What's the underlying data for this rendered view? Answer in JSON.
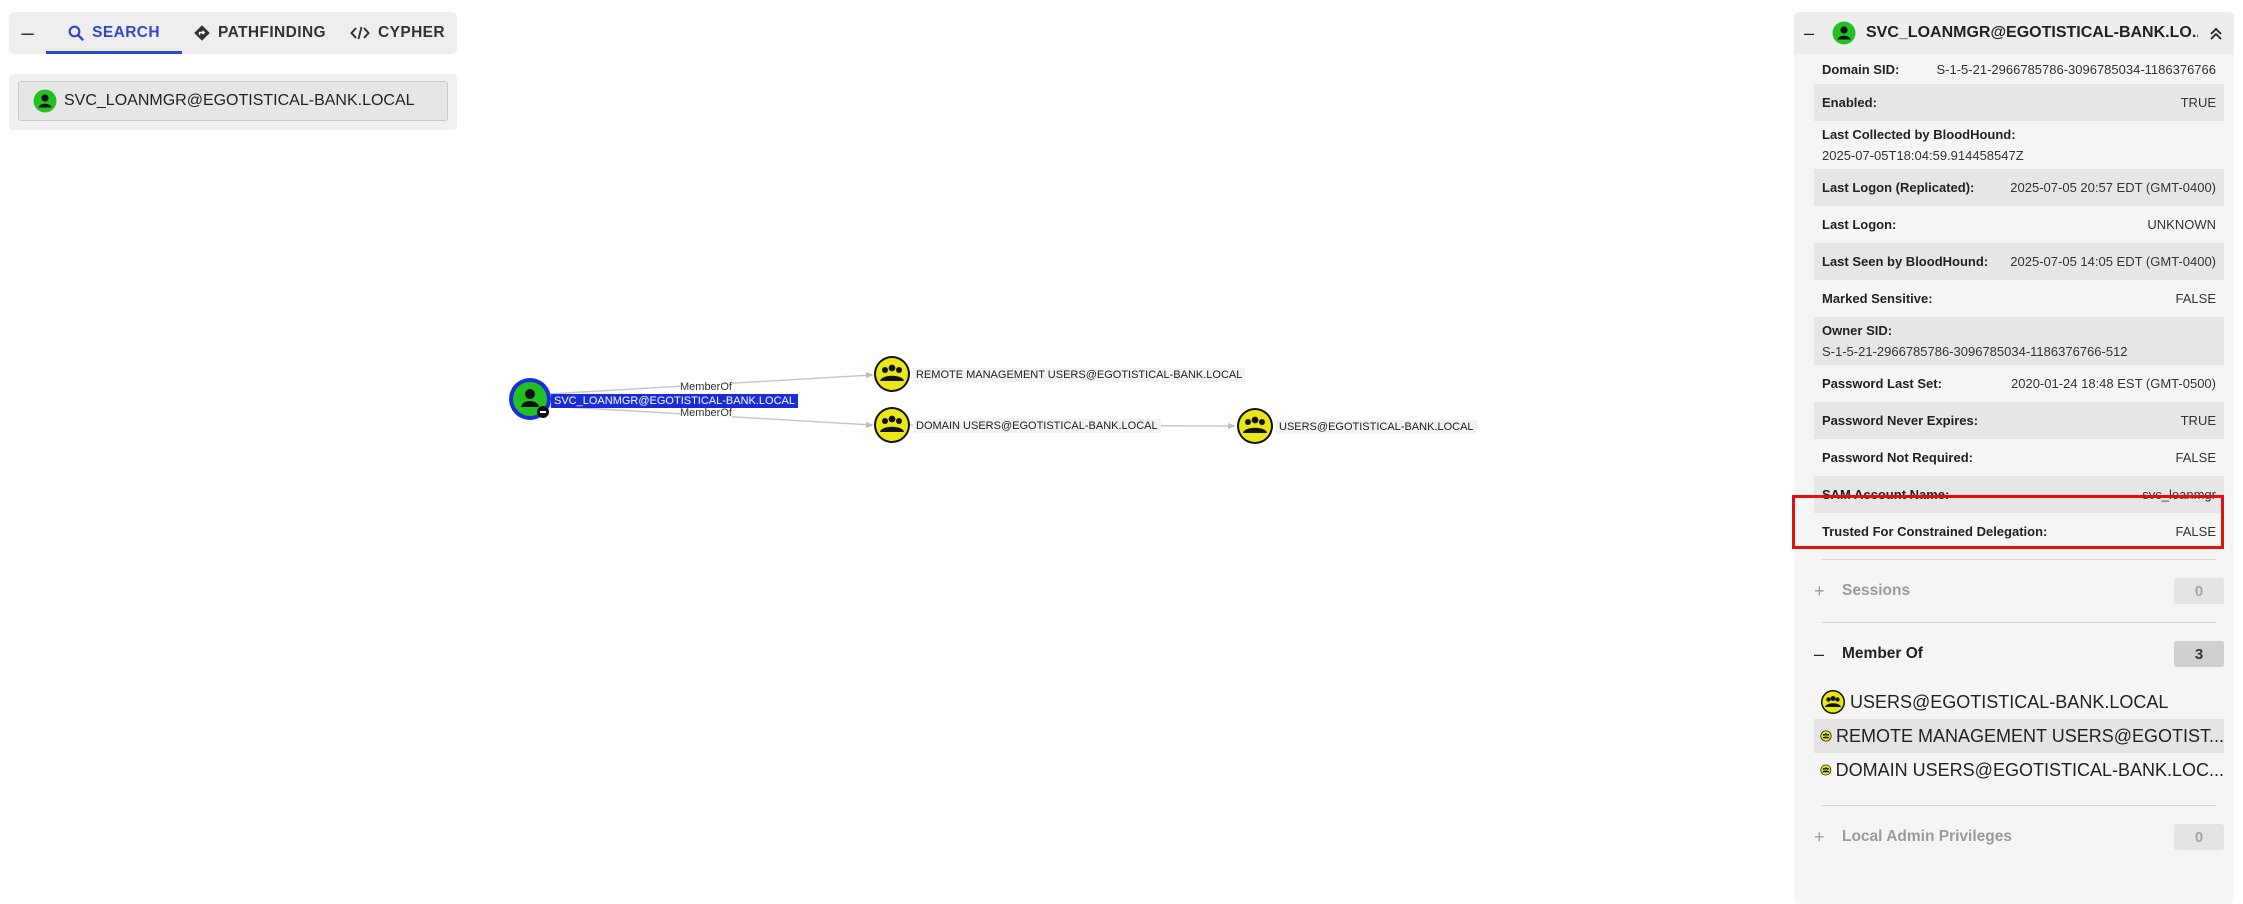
{
  "search_panel": {
    "collapse_symbol": "–",
    "tabs": [
      {
        "label": "SEARCH",
        "icon": "search-icon",
        "active": true
      },
      {
        "label": "PATHFINDING",
        "icon": "pathfinding-icon",
        "active": false
      },
      {
        "label": "CYPHER",
        "icon": "code-icon",
        "active": false
      }
    ],
    "search_value": "SVC_LOANMGR@EGOTISTICAL-BANK.LOCAL"
  },
  "graph": {
    "nodes": [
      {
        "label": "SVC_LOANMGR@EGOTISTICAL-BANK.LOCAL",
        "type": "user",
        "selected": true
      },
      {
        "label": "REMOTE MANAGEMENT USERS@EGOTISTICAL-BANK.LOCAL",
        "type": "group"
      },
      {
        "label": "DOMAIN USERS@EGOTISTICAL-BANK.LOCAL",
        "type": "group"
      },
      {
        "label": "USERS@EGOTISTICAL-BANK.LOCAL",
        "type": "group"
      }
    ],
    "edges": [
      {
        "label": "MemberOf"
      },
      {
        "label": "MemberOf"
      }
    ]
  },
  "detail_panel": {
    "title": "SVC_LOANMGR@EGOTISTICAL-BANK.LO...",
    "collapse_symbol": "–",
    "properties": [
      {
        "key": "Domain SID:",
        "value": "S-1-5-21-2966785786-3096785034-1186376766"
      },
      {
        "key": "Enabled:",
        "value": "TRUE"
      },
      {
        "key": "Last Collected by BloodHound:",
        "value": "2025-07-05T18:04:59.914458547Z"
      },
      {
        "key": "Last Logon (Replicated):",
        "value": "2025-07-05 20:57 EDT (GMT-0400)"
      },
      {
        "key": "Last Logon:",
        "value": "UNKNOWN"
      },
      {
        "key": "Last Seen by BloodHound:",
        "value": "2025-07-05 14:05 EDT (GMT-0400)"
      },
      {
        "key": "Marked Sensitive:",
        "value": "FALSE"
      },
      {
        "key": "Owner SID:",
        "value": "S-1-5-21-2966785786-3096785034-1186376766-512"
      },
      {
        "key": "Password Last Set:",
        "value": "2020-01-24 18:48 EST (GMT-0500)"
      },
      {
        "key": "Password Never Expires:",
        "value": "TRUE"
      },
      {
        "key": "Password Not Required:",
        "value": "FALSE"
      },
      {
        "key": "SAM Account Name:",
        "value": "svc_loanmgr"
      },
      {
        "key": "Trusted For Constrained Delegation:",
        "value": "FALSE"
      }
    ],
    "sessions": {
      "symbol": "+",
      "label": "Sessions",
      "count": "0"
    },
    "member_of": {
      "symbol": "–",
      "label": "Member Of",
      "count": "3",
      "items": [
        "USERS@EGOTISTICAL-BANK.LOCAL",
        "REMOTE MANAGEMENT USERS@EGOTIST...",
        "DOMAIN USERS@EGOTISTICAL-BANK.LOC..."
      ]
    },
    "local_admin": {
      "symbol": "+",
      "label": "Local Admin Privileges",
      "count": "0"
    }
  },
  "colors": {
    "accent": "#2e49c7",
    "user_node": "#22c022",
    "group_node": "#e8e819",
    "highlight": "#e01010",
    "selected_label": "#1a2bd8"
  }
}
